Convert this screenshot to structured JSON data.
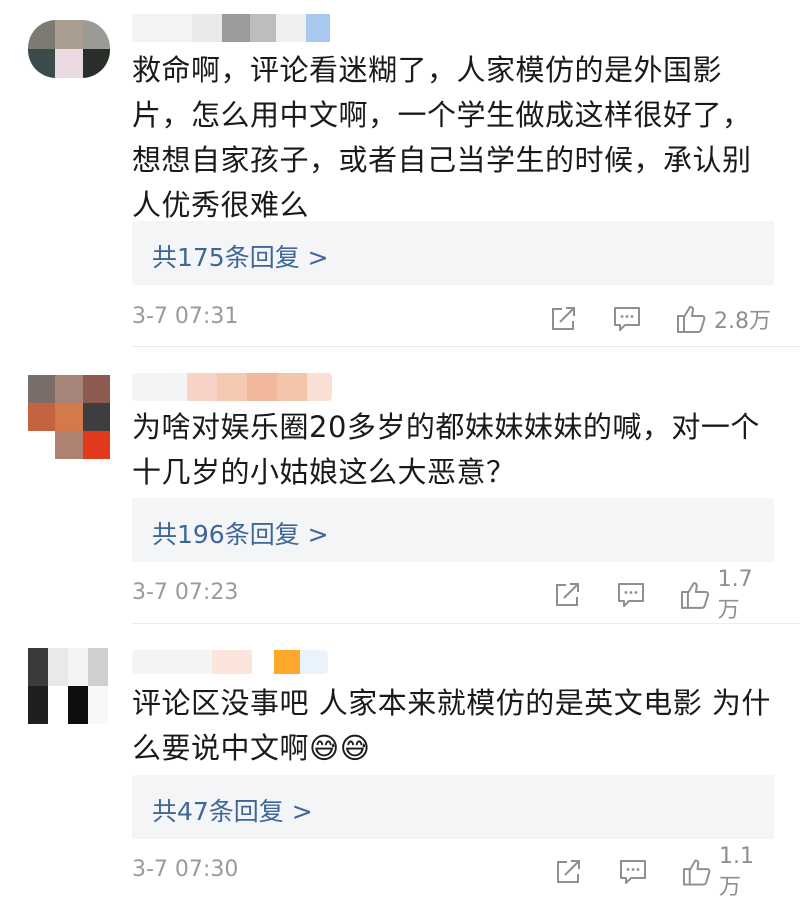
{
  "comments": [
    {
      "text": "救命啊，评论看迷糊了，人家模仿的是外国影片，怎么用中文啊，一个学生做成这样很好了，想想自家孩子，或者自己当学生的时候，承认别人优秀很难么",
      "replies_label": "共175条回复 >",
      "time": "3-7 07:31",
      "likes": "2.8万",
      "icons": [
        "share-icon",
        "comment-icon",
        "like-icon"
      ]
    },
    {
      "text": "为啥对娱乐圈20多岁的都妹妹妹妹的喊，对一个十几岁的小姑娘这么大恶意？",
      "replies_label": "共196条回复 >",
      "time": "3-7 07:23",
      "likes": "1.7万",
      "icons": [
        "share-icon",
        "comment-icon",
        "like-icon"
      ]
    },
    {
      "text": "评论区没事吧 人家本来就模仿的是英文电影 为什么要说中文啊😅😅",
      "replies_label": "共47条回复 >",
      "time": "3-7 07:30",
      "likes": "1.1万",
      "icons": [
        "share-icon",
        "comment-icon",
        "like-icon"
      ]
    }
  ],
  "colors": {
    "reply_link": "#3f6699",
    "reply_bg": "#f4f5f7",
    "meta_gray": "#9a9a9a"
  }
}
